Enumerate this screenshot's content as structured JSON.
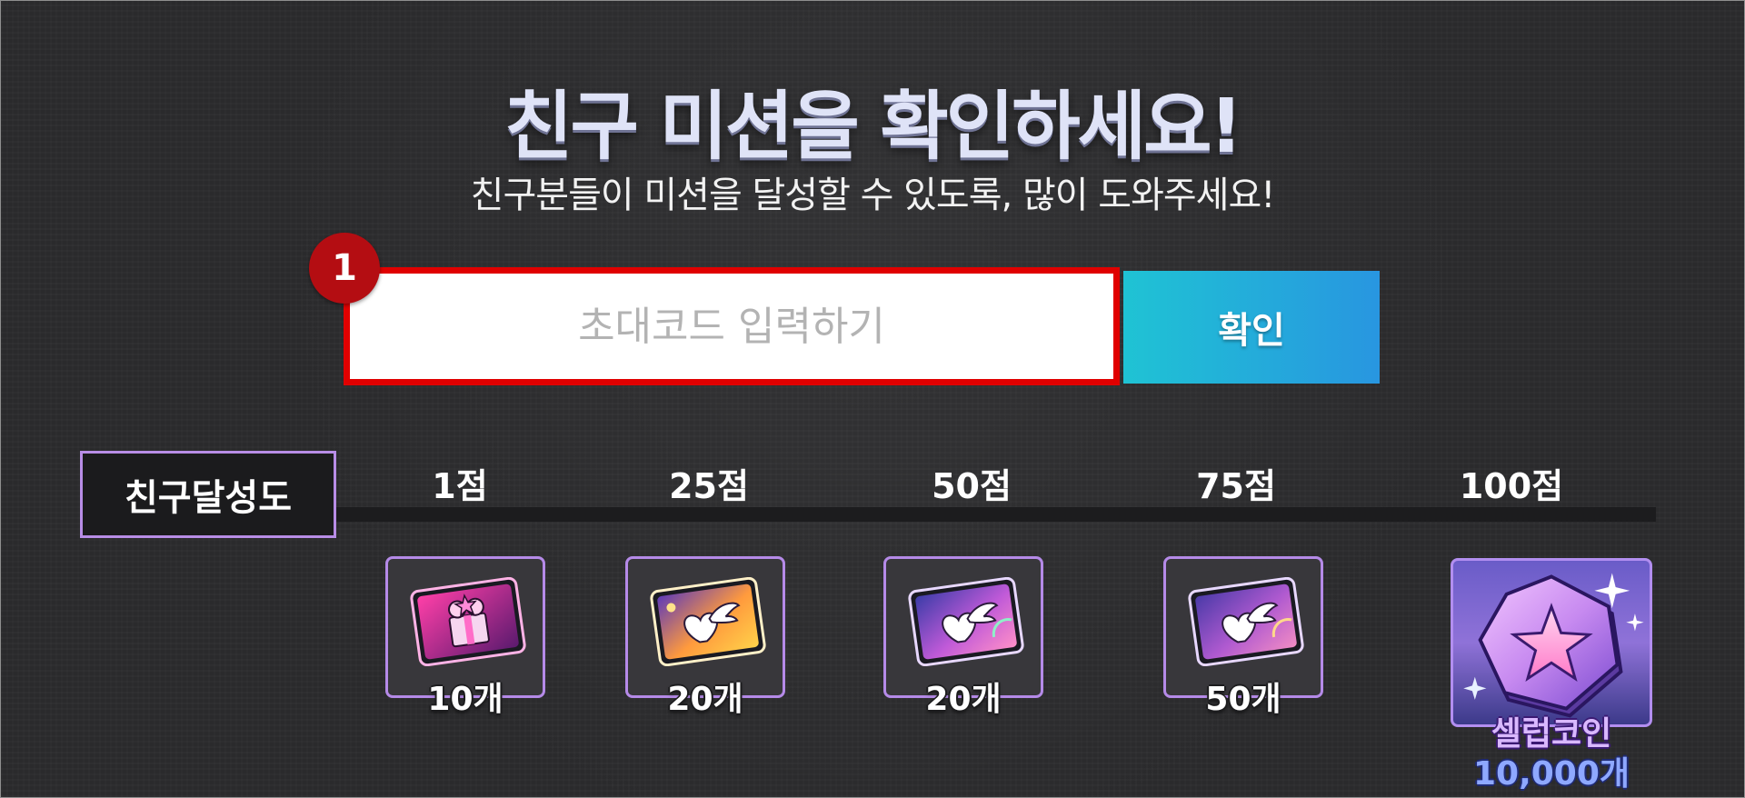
{
  "header": {
    "title": "친구 미션을 확인하세요!",
    "subtitle": "친구분들이 미션을 달성할 수 있도록, 많이 도와주세요!"
  },
  "invite_form": {
    "step_number": "1",
    "input_placeholder": "초대코드 입력하기",
    "input_value": "",
    "confirm_label": "확인"
  },
  "progress": {
    "label": "친구달성도",
    "milestones": [
      "1점",
      "25점",
      "50점",
      "75점",
      "100점"
    ]
  },
  "rewards": [
    {
      "icon": "gift-box-card-icon",
      "count": "10개"
    },
    {
      "icon": "winged-heart-card-icon",
      "count": "20개"
    },
    {
      "icon": "winged-heart-card-icon",
      "count": "20개"
    },
    {
      "icon": "winged-heart-card-icon",
      "count": "50개"
    }
  ],
  "grand_reward": {
    "icon": "celeb-coin-icon",
    "name": "셀럽코인",
    "count": "10,000개"
  },
  "colors": {
    "background": "#2a2a2c",
    "highlight_border": "#e00000",
    "step_badge": "#b40d12",
    "button_gradient_start": "#1fc3d4",
    "button_gradient_end": "#2896e0",
    "reward_border": "#b58ae8"
  }
}
